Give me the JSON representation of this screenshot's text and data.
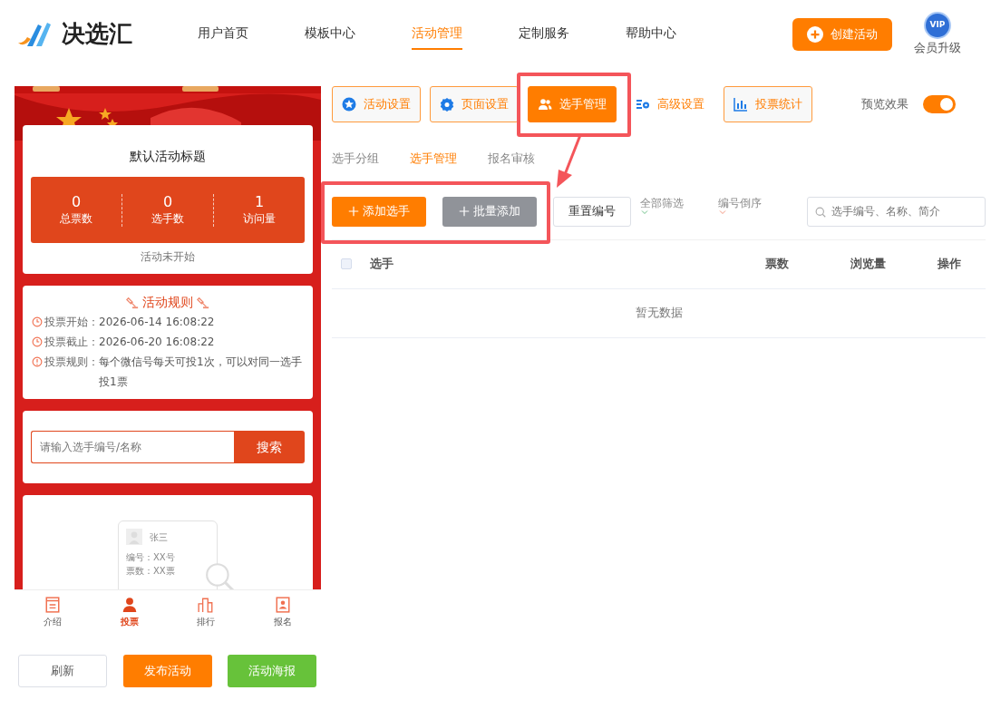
{
  "header": {
    "logo": "决选汇",
    "nav": [
      {
        "label": "用户首页",
        "selected": false
      },
      {
        "label": "模板中心",
        "selected": false
      },
      {
        "label": "活动管理",
        "selected": true
      },
      {
        "label": "定制服务",
        "selected": false
      },
      {
        "label": "帮助中心",
        "selected": false
      }
    ],
    "create_button": "创建活动",
    "vip_badge": "VIP",
    "vip_label": "会员升级"
  },
  "preview": {
    "title": "默认活动标题",
    "stats": [
      {
        "value": "0",
        "label": "总票数"
      },
      {
        "value": "0",
        "label": "选手数"
      },
      {
        "value": "1",
        "label": "访问量"
      }
    ],
    "status": "活动未开始",
    "rules_title": "活动规则",
    "rules": [
      {
        "kind": "clock",
        "label": "投票开始：",
        "value": "2026-06-14 16:08:22"
      },
      {
        "kind": "clock",
        "label": "投票截止：",
        "value": "2026-06-20 16:08:22"
      },
      {
        "kind": "alert",
        "label": "投票规则：",
        "value": "每个微信号每天可投1次，可以对同一选手投1票"
      }
    ],
    "search_placeholder": "请输入选手编号/名称",
    "search_button": "搜索",
    "empty_card": {
      "name": "张三",
      "number": "编号：XX号",
      "votes": "票数：XX票"
    },
    "bottom_nav": [
      {
        "label": "介绍",
        "selected": false
      },
      {
        "label": "投票",
        "selected": true
      },
      {
        "label": "排行",
        "selected": false
      },
      {
        "label": "报名",
        "selected": false
      }
    ]
  },
  "actions": [
    {
      "label": "刷新",
      "kind": "outline"
    },
    {
      "label": "发布活动",
      "kind": "orange"
    },
    {
      "label": "活动海报",
      "kind": "green"
    }
  ],
  "tabs": [
    {
      "label": "活动设置",
      "selected": false
    },
    {
      "label": "页面设置",
      "selected": false
    },
    {
      "label": "选手管理",
      "selected": true
    },
    {
      "label": "高级设置",
      "selected": false
    },
    {
      "label": "投票统计",
      "selected": false
    }
  ],
  "preview_toggle": {
    "label": "预览效果",
    "on": true
  },
  "subtabs": [
    {
      "label": "选手分组",
      "selected": false
    },
    {
      "label": "选手管理",
      "selected": true
    },
    {
      "label": "报名审核",
      "selected": false
    }
  ],
  "toolbar": {
    "add_button": "添加选手",
    "batch_button": "批量添加",
    "reset_button": "重置编号",
    "filters": [
      "全部筛选",
      "编号倒序"
    ],
    "search_placeholder": "选手编号、名称、简介"
  },
  "table": {
    "select_all_checked": false,
    "columns": [
      "选手",
      "票数",
      "浏览量",
      "操作"
    ],
    "empty": "暂无数据"
  }
}
